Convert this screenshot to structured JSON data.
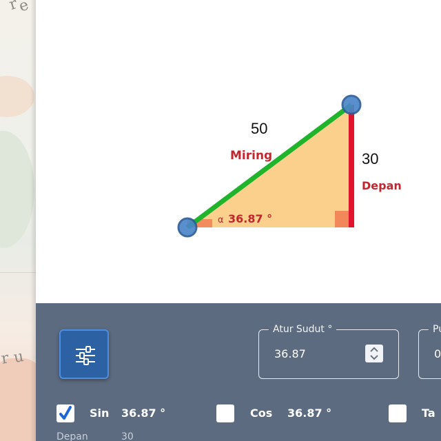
{
  "diagram": {
    "hypotenuse_value": "50",
    "hypotenuse_label": "Miring",
    "opposite_value": "30",
    "opposite_label": "Depan",
    "angle_symbol": "α",
    "angle_value": "36.87 °"
  },
  "colors": {
    "triangle_fill": "#fbd08c",
    "hypotenuse_line": "#1fb42c",
    "opposite_line": "#e0142c",
    "angle_marker": "#f07a50",
    "label_red": "#c2262e",
    "handle": "#4a86c8",
    "panel_bg": "#5d6b80",
    "settings_button": "#2c62a4"
  },
  "controls": {
    "settings_icon": "sliders-icon",
    "angle_field": {
      "legend": "Atur Sudut °",
      "value": "36.87"
    },
    "second_field": {
      "legend": "Pu",
      "value": "0"
    }
  },
  "functions": {
    "sin": {
      "label": "Sin",
      "value": "36.87 °",
      "checked": true
    },
    "cos": {
      "label": "Cos",
      "value": "36.87 °",
      "checked": false
    },
    "tan": {
      "label": "Ta",
      "checked": false
    }
  },
  "sub_row": {
    "label": "Depan",
    "value": "30"
  }
}
